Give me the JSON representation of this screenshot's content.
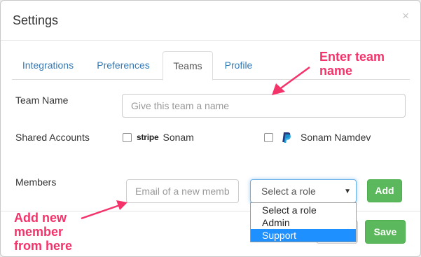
{
  "modal": {
    "title": "Settings",
    "close_glyph": "×"
  },
  "tabs": [
    {
      "label": "Integrations",
      "active": false
    },
    {
      "label": "Preferences",
      "active": false
    },
    {
      "label": "Teams",
      "active": true
    },
    {
      "label": "Profile",
      "active": false
    }
  ],
  "team_name": {
    "label": "Team Name",
    "placeholder": "Give this team a name",
    "value": ""
  },
  "shared_accounts": {
    "label": "Shared Accounts",
    "accounts": [
      {
        "provider": "stripe",
        "logo_text": "stripe",
        "name": "Sonam",
        "checked": false
      },
      {
        "provider": "paypal",
        "logo_icon": "paypal-icon",
        "name": "Sonam Namdev",
        "checked": false
      }
    ]
  },
  "members": {
    "label": "Members",
    "email_placeholder": "Email of a new member",
    "role_select": {
      "selected": "Select a role",
      "arrow_glyph": "▼"
    },
    "role_options": [
      "Select a role",
      "Admin",
      "Support"
    ],
    "highlighted_option": "Support",
    "add_label": "Add"
  },
  "footer": {
    "save_label": "Save"
  },
  "annotations": {
    "team_name_hint": "Enter team name",
    "member_hint": "Add new member from here",
    "color": "#f5336b"
  },
  "colors": {
    "primary": "#337ab7",
    "success": "#5cb85c",
    "highlight": "#1e90ff"
  }
}
